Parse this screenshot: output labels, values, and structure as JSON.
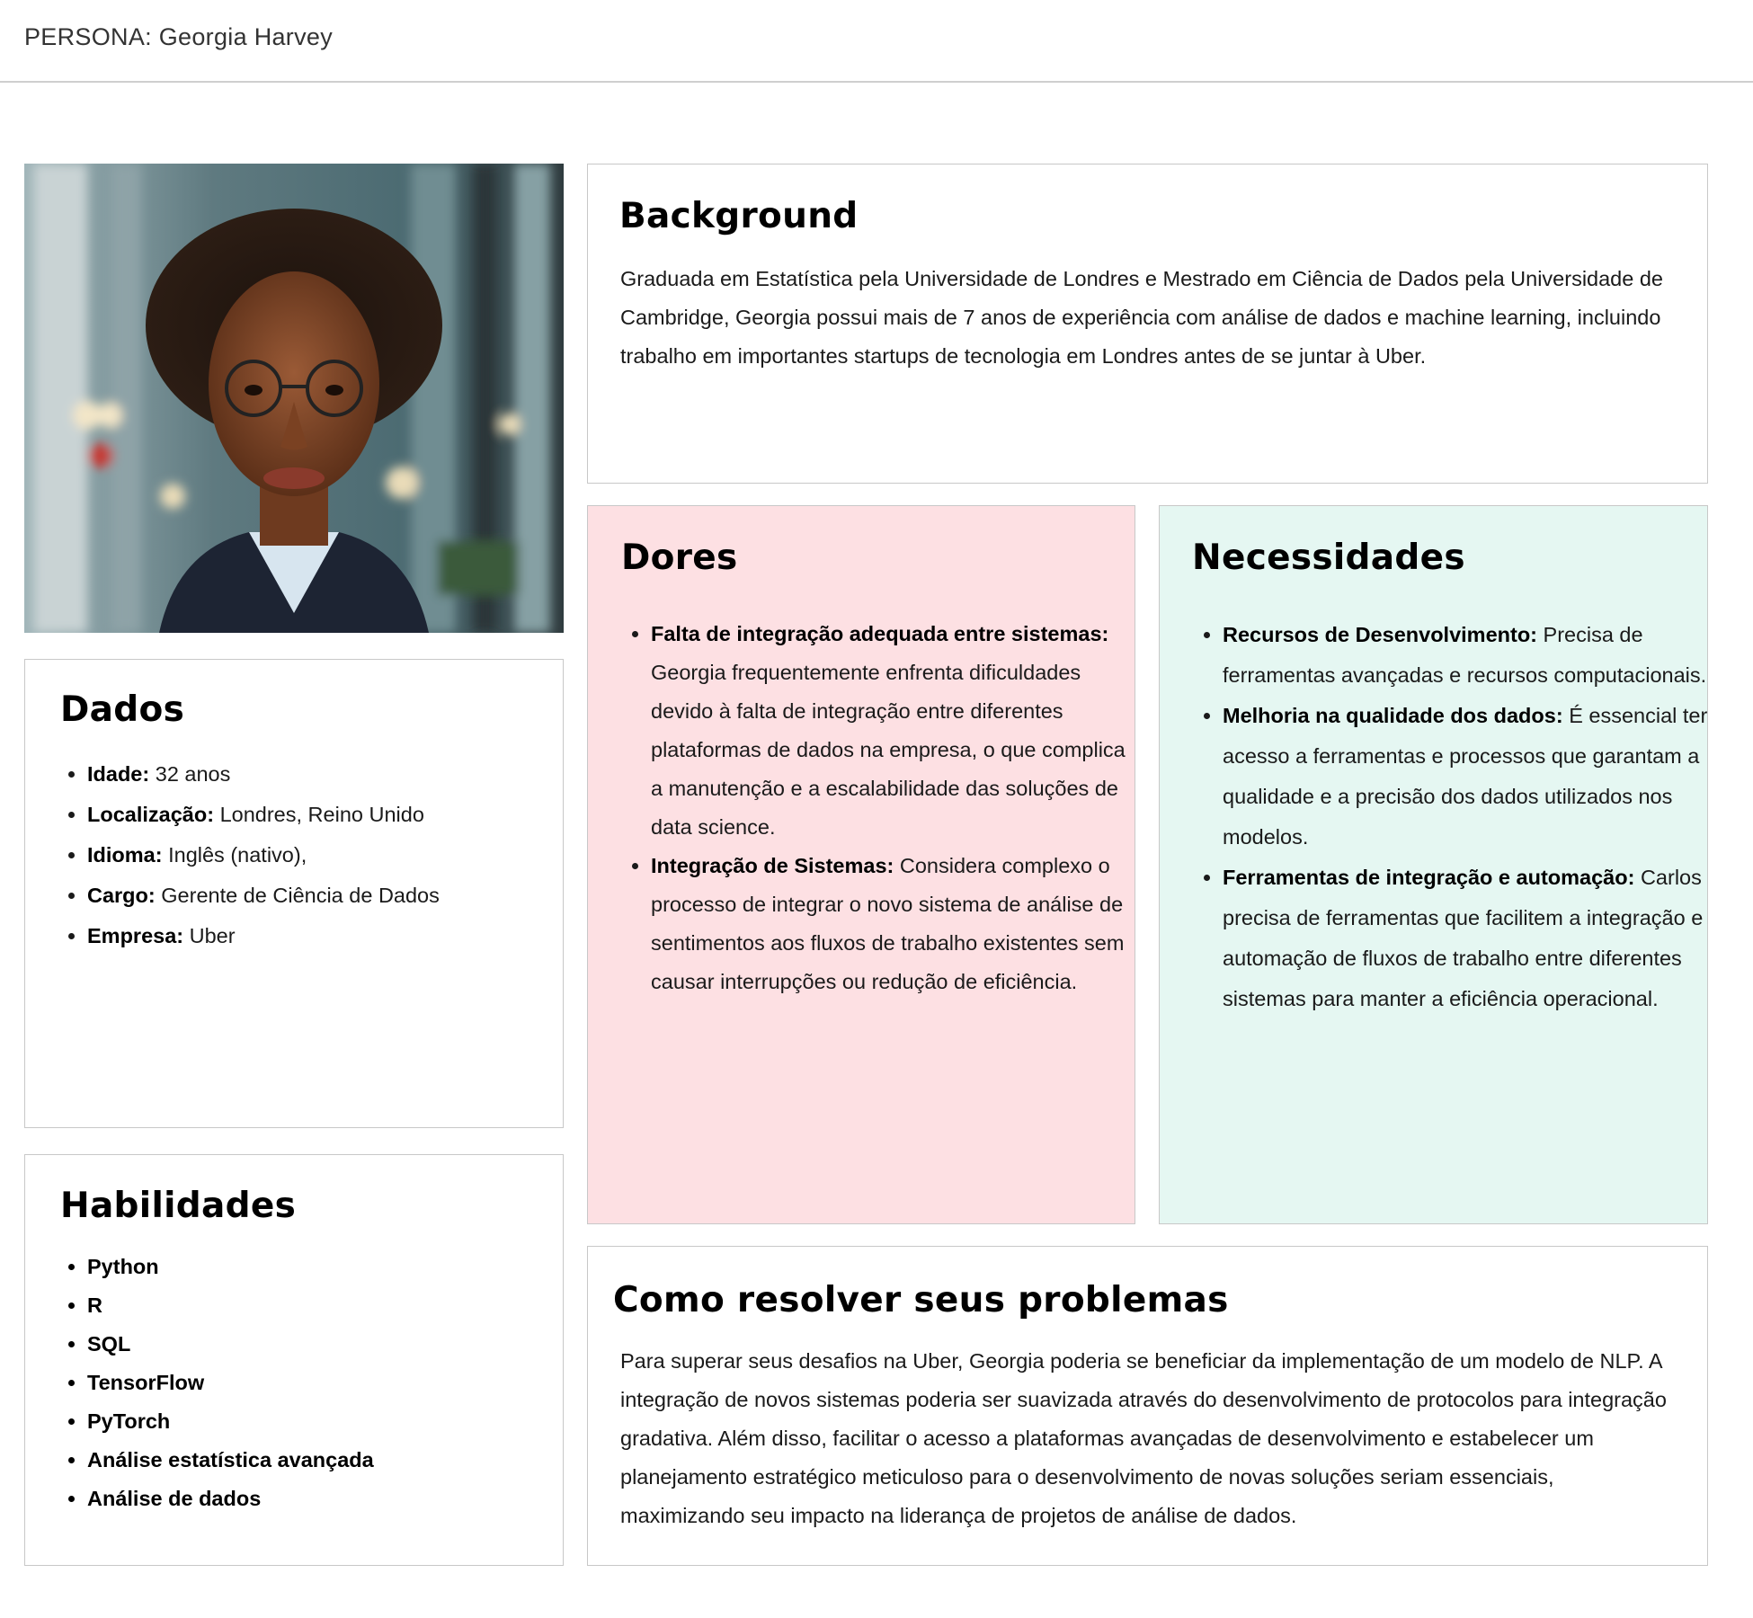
{
  "header": {
    "title": "PERSONA: Georgia Harvey"
  },
  "photo": {
    "alt": "Retrato de Georgia Harvey"
  },
  "background": {
    "heading": "Background",
    "text": "Graduada em Estatística pela Universidade de Londres e Mestrado em Ciência de Dados pela Universidade de Cambridge, Georgia possui mais de 7 anos de experiência com análise de dados e machine learning, incluindo trabalho em importantes startups de tecnologia em Londres antes de se juntar à Uber."
  },
  "dados": {
    "heading": "Dados",
    "items": [
      {
        "label": "Idade:",
        "value": " 32 anos"
      },
      {
        "label": "Localização:",
        "value": " Londres, Reino Unido"
      },
      {
        "label": "Idioma:",
        "value": " Inglês (nativo),"
      },
      {
        "label": "Cargo:",
        "value": " Gerente de Ciência de Dados"
      },
      {
        "label": "Empresa:",
        "value": " Uber"
      }
    ]
  },
  "habilidades": {
    "heading": "Habilidades",
    "items": [
      "Python",
      "R",
      "SQL",
      "TensorFlow",
      "PyTorch",
      "Análise estatística avançada",
      "Análise de dados"
    ]
  },
  "dores": {
    "heading": "Dores",
    "items": [
      {
        "label": "Falta de integração adequada entre sistemas:",
        "value": " Georgia frequentemente enfrenta dificuldades devido à falta de integração entre diferentes plataformas de dados na empresa, o que complica a manutenção e a escalabilidade das soluções de data science."
      },
      {
        "label": "Integração de Sistemas:",
        "value": " Considera complexo o processo de integrar o novo sistema de análise de sentimentos aos fluxos de trabalho existentes sem causar interrupções ou redução de eficiência."
      }
    ]
  },
  "necessidades": {
    "heading": "Necessidades",
    "items": [
      {
        "label": "Recursos de Desenvolvimento:",
        "value": " Precisa de ferramentas avançadas e recursos computacionais."
      },
      {
        "label": "Melhoria na qualidade dos dados:",
        "value": " É essencial ter acesso a ferramentas e processos que garantam a qualidade e a precisão dos dados utilizados nos modelos."
      },
      {
        "label": "Ferramentas de integração e automação:",
        "value": " Carlos precisa de ferramentas que facilitem a integração e automação de fluxos de trabalho entre diferentes sistemas para manter a eficiência operacional."
      }
    ]
  },
  "resolver": {
    "heading": "Como resolver seus problemas",
    "text": "Para superar seus desafios na Uber, Georgia poderia se beneficiar da implementação de um modelo de NLP. A integração de novos sistemas poderia ser suavizada através do desenvolvimento de protocolos para integração gradativa. Além disso, facilitar o acesso a plataformas avançadas de desenvolvimento e estabelecer um planejamento estratégico meticuloso para o desenvolvimento de novas soluções seriam essenciais, maximizando seu impacto na liderança de projetos de análise de dados."
  }
}
